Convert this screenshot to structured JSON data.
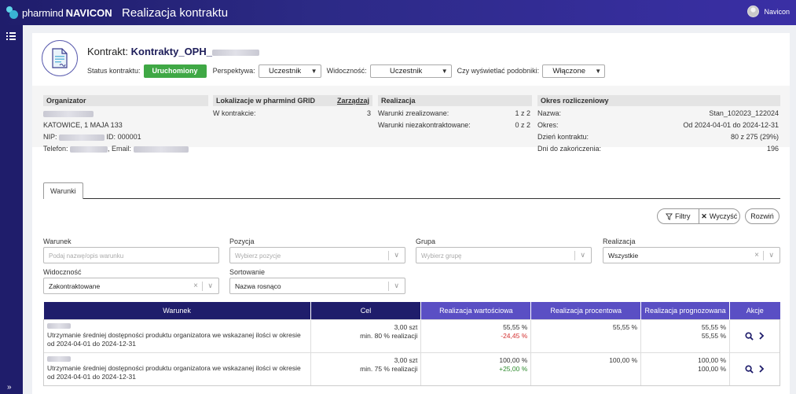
{
  "app": {
    "brand_prefix": "pharmind",
    "brand_name": "NAVICON",
    "page_title": "Realizacja kontraktu",
    "user_name": "Navicon"
  },
  "contract": {
    "label": "Kontrakt:",
    "name": "Kontrakty_OPH_"
  },
  "controls": {
    "status_label": "Status kontraktu:",
    "status_value": "Uruchomiony",
    "status_color": "#3fa845",
    "perspective_label": "Perspektywa:",
    "perspective_value": "Uczestnik",
    "visibility_label": "Widoczność:",
    "visibility_value": "Uczestnik",
    "similar_label": "Czy wyświetlać podobniki:",
    "similar_value": "Włączone"
  },
  "organizer": {
    "title": "Organizator",
    "address": "KATOWICE, 1 MAJA 133",
    "nip_label": "NIP:",
    "id_label": "ID:",
    "id_value": "000001",
    "phone_label": "Telefon:",
    "email_label": ", Email:"
  },
  "location": {
    "title": "Lokalizacje w pharmind GRID",
    "manage_label": "Zarządzaj",
    "in_contract_label": "W kontrakcie:",
    "in_contract_value": "3"
  },
  "realization": {
    "title": "Realizacja",
    "done_label": "Warunki zrealizowane:",
    "done_value": "1 z 2",
    "uncontracted_label": "Warunki niezakontraktowane:",
    "uncontracted_value": "0 z 2"
  },
  "period": {
    "title": "Okres rozliczeniowy",
    "name_label": "Nazwa:",
    "name_value": "Stan_102023_122024",
    "period_label": "Okres:",
    "period_value": "Od 2024-04-01 do 2024-12-31",
    "day_label": "Dzień kontraktu:",
    "day_value": "80 z 275 (29%)",
    "left_label": "Dni do zakończenia:",
    "left_value": "196"
  },
  "tabs": {
    "conditions": "Warunki"
  },
  "toolbar": {
    "filters": "Filtry",
    "clear": "Wyczyść",
    "collapse": "Rozwiń"
  },
  "filters": {
    "condition": {
      "label": "Warunek",
      "placeholder": "Podaj nazwę/opis warunku"
    },
    "position": {
      "label": "Pozycja",
      "placeholder": "Wybierz pozycje"
    },
    "group": {
      "label": "Grupa",
      "placeholder": "Wybierz grupę"
    },
    "realization": {
      "label": "Realizacja",
      "value": "Wszystkie"
    },
    "visibility": {
      "label": "Widoczność",
      "value": "Zakontraktowane"
    },
    "sort": {
      "label": "Sortowanie",
      "value": "Nazwa rosnąco"
    }
  },
  "table": {
    "headers": [
      "Warunek",
      "Cel",
      "Realizacja wartościowa",
      "Realizacja procentowa",
      "Realizacja prognozowana",
      "Akcje"
    ],
    "rows": [
      {
        "description": "Utrzymanie średniej dostępności produktu organizatora we wskazanej ilości w okresie od 2024-04-01 do 2024-12-31",
        "target_value": "3,00 szt",
        "target_min": "min. 80 % realizacji",
        "value_pct": "55,55 %",
        "value_diff": "-24,45 %",
        "percent": "55,55 %",
        "forecast_1": "55,55 %",
        "forecast_2": "55,55 %"
      },
      {
        "description": "Utrzymanie średniej dostępności produktu organizatora we wskazanej ilości w okresie od 2024-04-01 do 2024-12-31",
        "target_value": "3,00 szt",
        "target_min": "min. 75 % realizacji",
        "value_pct": "100,00 %",
        "value_diff": "+25,00 %",
        "percent": "100,00 %",
        "forecast_1": "100,00 %",
        "forecast_2": "100,00 %"
      }
    ]
  }
}
